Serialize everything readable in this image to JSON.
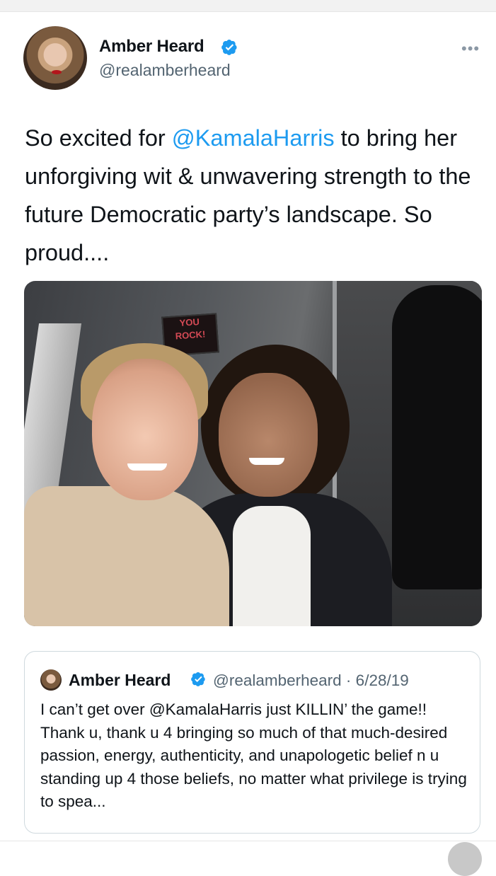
{
  "author": {
    "name": "Amber Heard",
    "handle": "@realamberheard"
  },
  "tweet": {
    "text_before": "So excited for ",
    "mention": "@KamalaHarris",
    "text_after": " to bring her unforgiving wit & unwavering strength to the future Democratic party’s landscape. So proud...."
  },
  "photo": {
    "sign_line1": "YOU",
    "sign_line2": "ROCK!"
  },
  "quoted_tweet": {
    "name": "Amber Heard",
    "meta": "@realamberheard · 6/28/19",
    "text": "I can’t get over @KamalaHarris just KILLIN’ the game!! Thank u, thank u 4 bringing so much of that much-desired passion, energy, authenticity, and unapologetic belief n u standing up 4 those beliefs, no matter what privilege is trying to spea..."
  },
  "icons": {
    "verified": "verified-badge-icon",
    "more": "more-options-icon"
  },
  "colors": {
    "accent": "#1d9bf0",
    "text": "#0f1419",
    "secondary": "#536471"
  }
}
